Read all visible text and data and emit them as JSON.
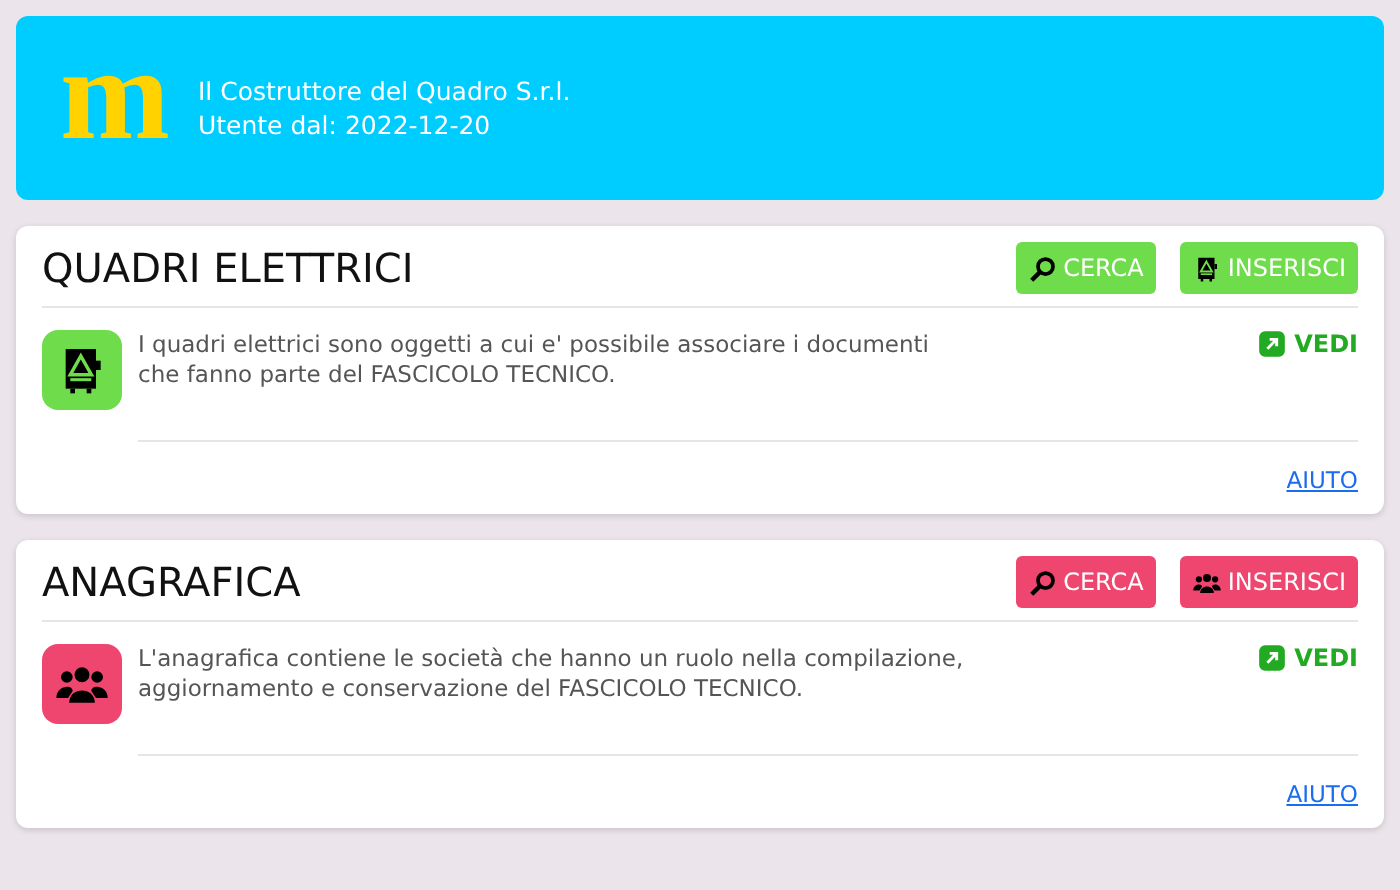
{
  "header": {
    "logo": "m",
    "company": "Il Costruttore del Quadro S.r.l.",
    "user_since": "Utente dal: 2022-12-20"
  },
  "sections": [
    {
      "title": "QUADRI ELETTRICI",
      "kind": "panel",
      "color": "#6fdd4b",
      "buttons": [
        {
          "label": "CERCA",
          "kind": "search"
        },
        {
          "label": "INSERISCI",
          "kind": "insert"
        }
      ],
      "description": "I quadri elettrici sono oggetti a cui e' possibile associare i documenti\nche fanno parte del FASCICOLO TECNICO.",
      "view_link": "VEDI",
      "help_link": "AIUTO"
    },
    {
      "title": "ANAGRAFICA",
      "kind": "people",
      "color": "#ef4670",
      "buttons": [
        {
          "label": "CERCA",
          "kind": "search"
        },
        {
          "label": "INSERISCI",
          "kind": "insert"
        }
      ],
      "description": "L'anagrafica contiene le società che hanno un ruolo nella compilazione,\naggiornamento e conservazione del FASCICOLO TECNICO.",
      "view_link": "VEDI",
      "help_link": "AIUTO"
    }
  ]
}
